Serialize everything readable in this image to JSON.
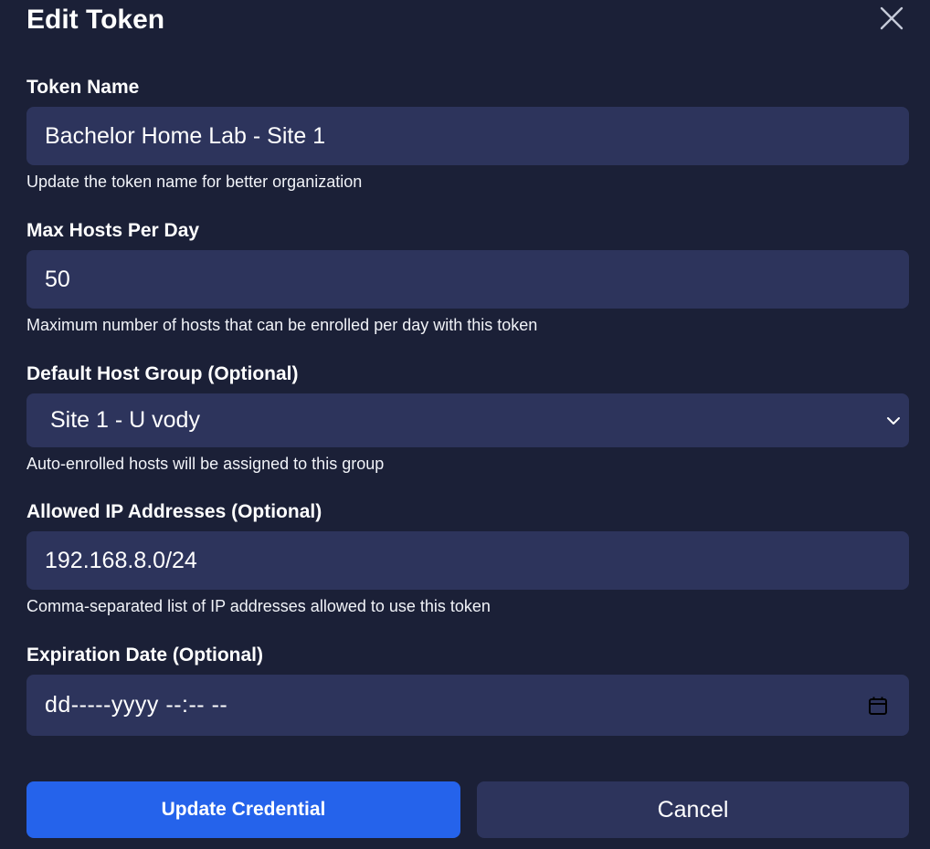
{
  "dialog": {
    "title": "Edit Token",
    "close_icon": "close-icon"
  },
  "form": {
    "token_name": {
      "label": "Token Name",
      "value": "Bachelor Home Lab - Site 1",
      "help": "Update the token name for better organization"
    },
    "max_hosts": {
      "label": "Max Hosts Per Day",
      "value": "50",
      "help": "Maximum number of hosts that can be enrolled per day with this token"
    },
    "host_group": {
      "label": "Default Host Group (Optional)",
      "selected": "Site 1 - U vody",
      "help": "Auto-enrolled hosts will be assigned to this group",
      "icon": "chevron-down-icon"
    },
    "allowed_ips": {
      "label": "Allowed IP Addresses (Optional)",
      "value": "192.168.8.0/24",
      "help": "Comma-separated list of IP addresses allowed to use this token"
    },
    "expiration": {
      "label": "Expiration Date (Optional)",
      "value": "dd-----yyyy --:-- --",
      "icon": "calendar-icon"
    }
  },
  "actions": {
    "submit_label": "Update Credential",
    "cancel_label": "Cancel"
  },
  "colors": {
    "background": "#1b2037",
    "field": "#2d345c",
    "primary": "#2563eb"
  }
}
